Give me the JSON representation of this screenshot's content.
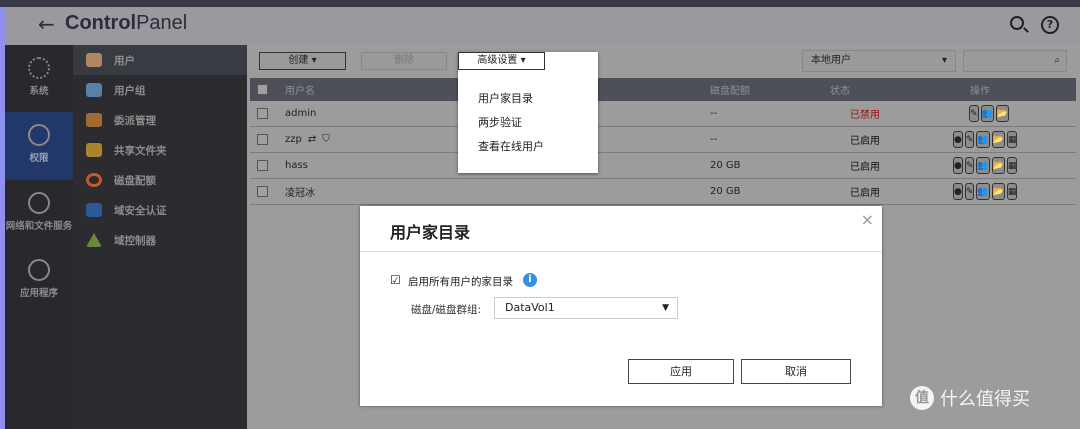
{
  "header": {
    "back_icon": "arrow-left",
    "title_bold": "Control",
    "title_rest": "Panel",
    "help": "?"
  },
  "nav_main": [
    {
      "label": "系统",
      "icon": "gear-icon"
    },
    {
      "label": "权限",
      "icon": "user-icon"
    },
    {
      "label": "网络和文件服务",
      "icon": "globe-icon"
    },
    {
      "label": "应用程序",
      "icon": "apps-icon"
    }
  ],
  "nav_sub": [
    {
      "label": "用户",
      "color": "#c8a070"
    },
    {
      "label": "用户组",
      "color": "#5a8ac0"
    },
    {
      "label": "委派管理",
      "color": "#c07030"
    },
    {
      "label": "共享文件夹",
      "color": "#c0952a"
    },
    {
      "label": "磁盘配额",
      "color": "#d04a2a"
    },
    {
      "label": "域安全认证",
      "color": "#2a5a9a"
    },
    {
      "label": "域控制器",
      "color": "#3a8a3a"
    }
  ],
  "toolbar": {
    "create": "创建",
    "delete": "删除",
    "advanced": "高级设置",
    "filter": "本地用户"
  },
  "table": {
    "headers": {
      "username": "用户名",
      "quota": "磁盘配额",
      "status": "状态",
      "actions": "操作"
    },
    "rows": [
      {
        "username": "admin",
        "quota": "--",
        "status": "已禁用",
        "status_color": "#a01010",
        "full": false
      },
      {
        "username": "zzp",
        "quota": "--",
        "status": "已启用",
        "status_color": "#111",
        "full": true
      },
      {
        "username": "hass",
        "quota": "20 GB",
        "status": "已启用",
        "status_color": "#111",
        "full": true
      },
      {
        "username": "凌冠冰",
        "quota": "20 GB",
        "status": "已启用",
        "status_color": "#111",
        "full": true
      }
    ]
  },
  "dropdown": {
    "items": [
      "用户家目录",
      "两步验证",
      "查看在线用户"
    ]
  },
  "dialog": {
    "title": "用户家目录",
    "checkbox_label": "启用所有用户的家目录",
    "checked": true,
    "volume_label": "磁盘/磁盘群组:",
    "volume_value": "DataVol1",
    "apply": "应用",
    "cancel": "取消"
  },
  "watermark": {
    "icon_char": "值",
    "text": "什么值得买"
  }
}
